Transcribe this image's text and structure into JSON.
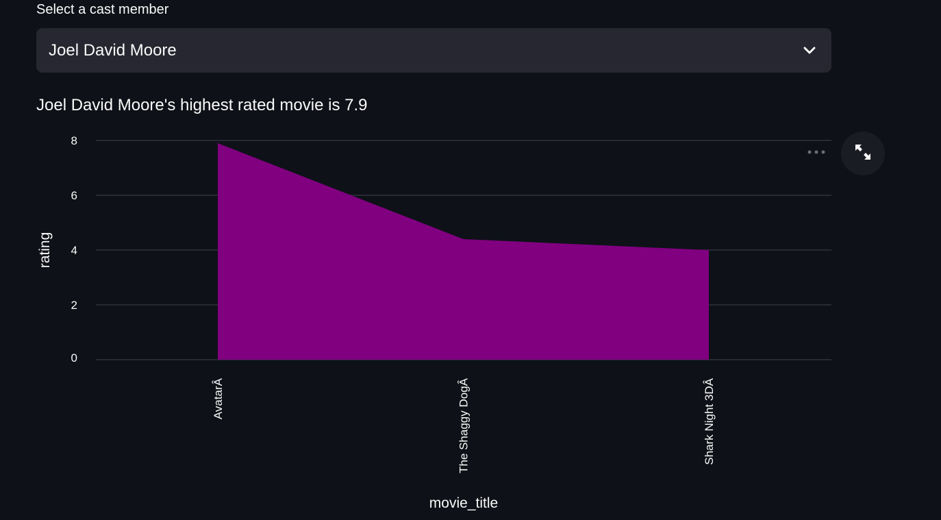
{
  "select": {
    "label": "Select a cast member",
    "value": "Joel David Moore",
    "icon": "chevron-down-icon"
  },
  "headline": "Joel David Moore's highest rated movie is 7.9",
  "toolbar": {
    "more_icon": "more-horizontal-icon",
    "expand_icon": "fullscreen-expand-icon"
  },
  "colors": {
    "background": "#0e1117",
    "select_bg": "#262730",
    "area_fill": "#800080",
    "grid": "#31333f",
    "text": "#fafafa"
  },
  "chart_data": {
    "type": "area",
    "categories": [
      "AvatarÂ",
      "The Shaggy DogÂ",
      "Shark Night 3DÂ"
    ],
    "values": [
      7.9,
      4.4,
      4.0
    ],
    "xlabel": "movie_title",
    "ylabel": "rating",
    "ylim": [
      0,
      8
    ],
    "yticks": [
      0,
      2,
      4,
      6,
      8
    ],
    "grid": true
  }
}
